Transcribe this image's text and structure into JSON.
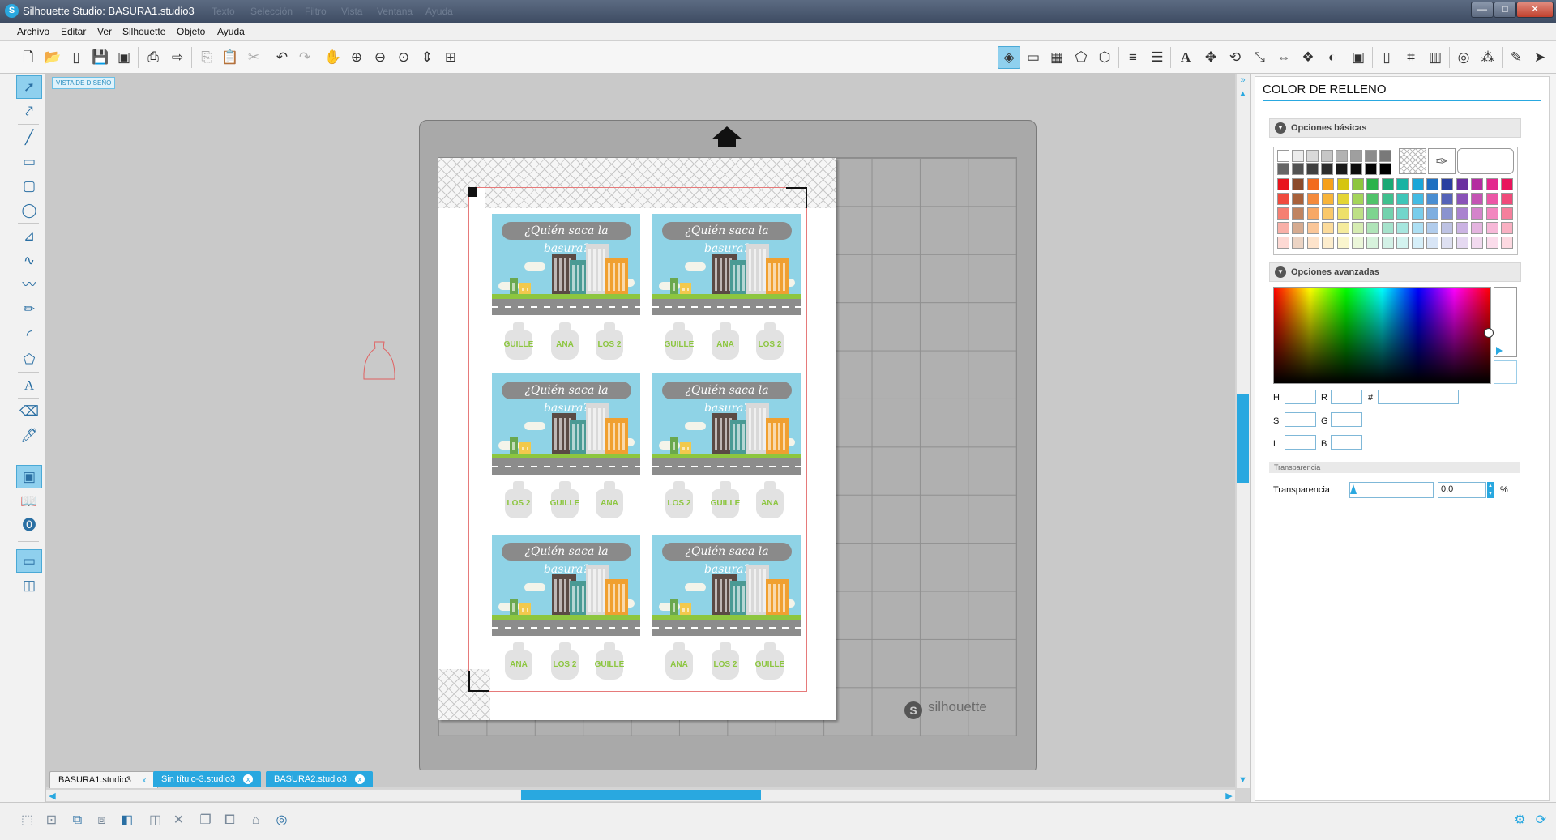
{
  "window": {
    "title": "Silhouette Studio: BASURA1.studio3",
    "ghost_menus": [
      "Texto",
      "Selección",
      "Filtro",
      "Vista",
      "Ventana",
      "Ayuda"
    ],
    "minimize": "—",
    "maximize": "□",
    "close": "✕"
  },
  "menu": [
    "Archivo",
    "Editar",
    "Ver",
    "Silhouette",
    "Objeto",
    "Ayuda"
  ],
  "canvas": {
    "view_label": "VISTA DE DISEÑO",
    "card_title": "¿Quién saca la basura?",
    "brand": "silhouette",
    "cards": [
      {
        "bags": [
          "GUILLE",
          "ANA",
          "LOS 2"
        ]
      },
      {
        "bags": [
          "GUILLE",
          "ANA",
          "LOS 2"
        ]
      },
      {
        "bags": [
          "LOS 2",
          "GUILLE",
          "ANA"
        ]
      },
      {
        "bags": [
          "LOS 2",
          "GUILLE",
          "ANA"
        ]
      },
      {
        "bags": [
          "ANA",
          "LOS 2",
          "GUILLE"
        ]
      },
      {
        "bags": [
          "ANA",
          "LOS 2",
          "GUILLE"
        ]
      }
    ]
  },
  "tabs": [
    {
      "label": "BASURA1.studio3",
      "active": true
    },
    {
      "label": "Sin título-3.studio3",
      "active": false
    },
    {
      "label": "BASURA2.studio3",
      "active": false
    }
  ],
  "panel": {
    "title": "COLOR DE RELLENO",
    "basic": "Opciones básicas",
    "advanced": "Opciones avanzadas",
    "fields": {
      "h": "H",
      "r": "R",
      "hash": "#",
      "s": "S",
      "g": "G",
      "l": "L",
      "b": "B"
    },
    "transparency_section": "Transparencia",
    "transparency_label": "Transparencia",
    "transparency_value": "0,0",
    "percent": "%"
  },
  "colors": {
    "accent": "#29a8e0",
    "grays": [
      "#ffffff",
      "#ececec",
      "#d9d9d9",
      "#c6c6c6",
      "#b2b2b2",
      "#9f9f9f",
      "#8c8c8c",
      "#797979",
      "#666666",
      "#535353",
      "#404040",
      "#2d2d2d",
      "#1a1a1a",
      "#0d0d0d",
      "#050505",
      "#000000"
    ],
    "palette_rows": [
      [
        "#e8141c",
        "#8b4a2a",
        "#f26b1d",
        "#f6a01a",
        "#d6c50f",
        "#8dc63f",
        "#2bb34a",
        "#19a974",
        "#17b3a3",
        "#1aa6d8",
        "#1e6fc1",
        "#2a3fa0",
        "#6b2fa0",
        "#b42da0",
        "#e3278e",
        "#e8145c"
      ],
      [
        "#f04a3e",
        "#a8613b",
        "#f48a3c",
        "#f8b43a",
        "#e4d534",
        "#a4d45a",
        "#4fc36a",
        "#3fc08e",
        "#3ec6b8",
        "#43bbe3",
        "#4a8ed2",
        "#5563b8",
        "#8a52b8",
        "#c454b4",
        "#ec57a6",
        "#f04a7a"
      ],
      [
        "#f57f72",
        "#c08460",
        "#f7a866",
        "#fac869",
        "#eee06a",
        "#bde085",
        "#7ed48f",
        "#72d2ad",
        "#72d6cb",
        "#78cdeb",
        "#7eaee0",
        "#8a93cf",
        "#aa82cf",
        "#d483cb",
        "#f287bf",
        "#f57f9c"
      ],
      [
        "#f9b0a8",
        "#d6ab90",
        "#fac698",
        "#fcdb9b",
        "#f5eb9d",
        "#d6ecb2",
        "#afe4b8",
        "#a6e3cc",
        "#a6e6de",
        "#addff3",
        "#b1ccec",
        "#bdc2e3",
        "#cbb3e3",
        "#e4b4df",
        "#f7b8d8",
        "#f9b0c2"
      ],
      [
        "#fdd9d4",
        "#ecd4c4",
        "#fde3cb",
        "#fdedcd",
        "#faf5ce",
        "#ebf6d9",
        "#d7f2dc",
        "#d3f1e6",
        "#d3f3ef",
        "#d6eff9",
        "#d8e5f6",
        "#dee0f1",
        "#e5d9f1",
        "#f2daef",
        "#fbdceb",
        "#fdd9e1"
      ]
    ]
  }
}
